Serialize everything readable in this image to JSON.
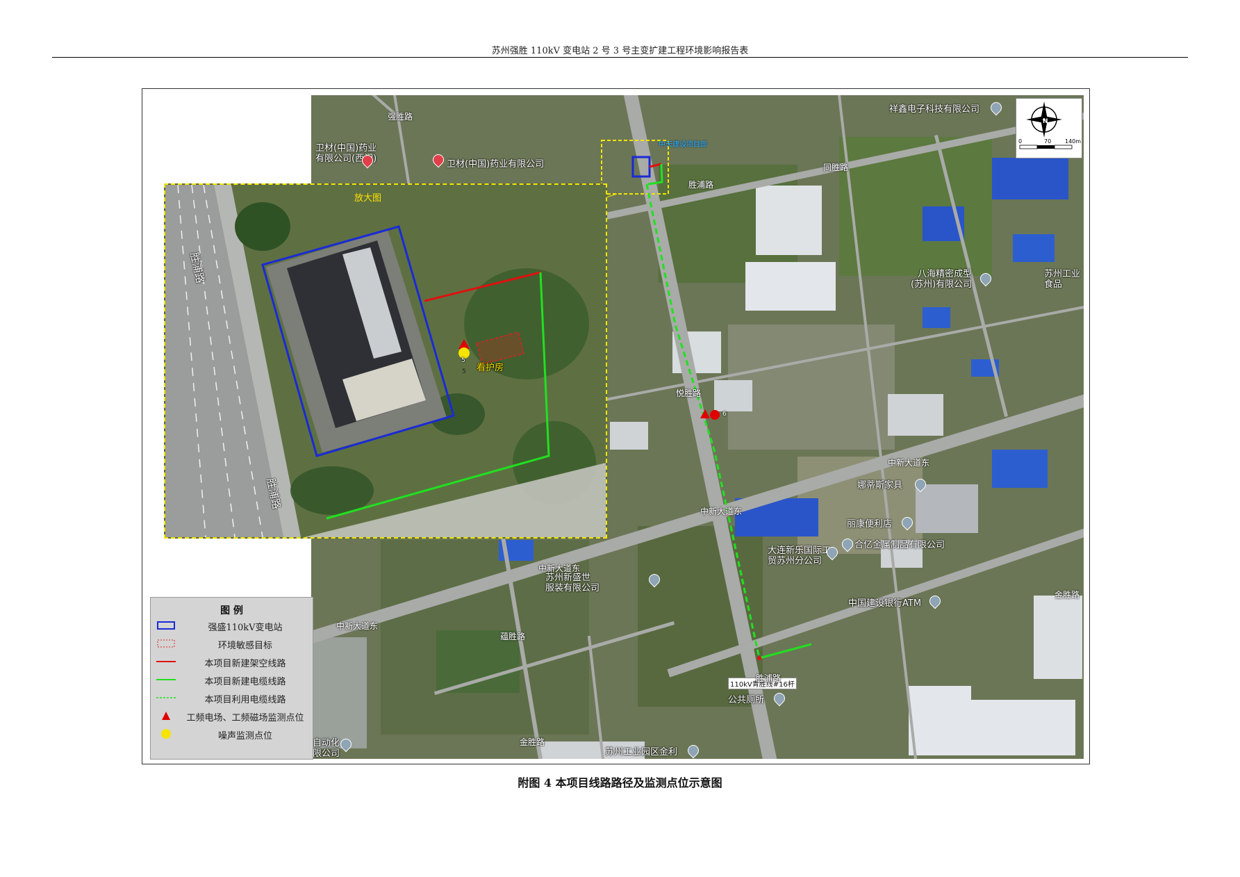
{
  "header": {
    "title": "苏州强胜 110kV 变电站 2 号 3 号主变扩建工程环境影响报告表"
  },
  "caption": "附图 4    本项目线路路径及监测点位示意图",
  "colors": {
    "substation": "#1a2ad6",
    "sensitive_target": "#e02020",
    "overhead_line": "#e01010",
    "cable_line": "#21e021",
    "existing_cable": "#21e021",
    "em_point": "#e00000",
    "noise_point": "#f5e400",
    "inset_border": "#f3e600"
  },
  "map": {
    "north_label": "N",
    "scale": {
      "zero": "0",
      "mid": "70",
      "end": "140m"
    },
    "places": {
      "xiangxin": "祥鑫电子科技有限公司",
      "weicai_west": "卫材(中国)药业\n有限公司(西门)",
      "weicai": "卫材(中国)药业有限公司",
      "project_dept": "中天建设项目部",
      "bahai": "八海精密成型\n(苏州)有限公司",
      "suzhou_food": "苏州工业\n食品",
      "nuodi": "娜蒂斯家具",
      "lixiang": "丽康便利店",
      "heyi": "合亿金属制品有限公司",
      "dalian": "大连新乐国际工\n贸苏州分公司",
      "ccb": "中国建设银行ATM",
      "xinshengshi": "苏州新盛世\n服装有限公司",
      "tower": "110kV青胜线#16杆",
      "toilet": "公共厕所",
      "zidonghua": "自动化\n限公司",
      "suzhou_park": "苏州工业园区金利"
    },
    "roads": {
      "qiangsheng": "强胜路",
      "tongsheng": "同胜路",
      "shengpu_1": "胜浦路",
      "shengpu_2": "胜浦路",
      "zhongxin_1": "中新大道东",
      "zhongxin_2": "中新大道东",
      "zhongxin_3": "中新大道东",
      "zhongxin_4": "中新大道东",
      "jinsheng_1": "金胜路",
      "jinsheng_2": "金胜路",
      "yunsheng": "蕴胜路",
      "yuesheng": "悦胜路"
    },
    "point_labels": {
      "em_6": "6"
    },
    "inset": {
      "title": "放大图",
      "road_1": "胜浦路",
      "road_2": "胜浦路",
      "guard_house": "看护房",
      "em_5": "5",
      "noise_5": "5"
    }
  },
  "legend": {
    "title": "图  例",
    "items": [
      {
        "symbol": "substation-box",
        "label": "强盛110kV变电站"
      },
      {
        "symbol": "sensitive-box",
        "label": "环境敏感目标"
      },
      {
        "symbol": "overhead-line",
        "label": "本项目新建架空线路"
      },
      {
        "symbol": "cable-line",
        "label": "本项目新建电缆线路"
      },
      {
        "symbol": "existing-cable",
        "label": "本项目利用电缆线路"
      },
      {
        "symbol": "em-triangle",
        "label": "工频电场、工频磁场监测点位"
      },
      {
        "symbol": "noise-dot",
        "label": "噪声监测点位"
      }
    ]
  }
}
